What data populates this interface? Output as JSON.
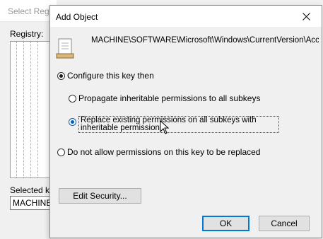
{
  "background_dialog": {
    "title": "Select Regi",
    "registry_label": "Registry:",
    "selected_key_label": "Selected ke",
    "selected_key_value": "MACHINE\\"
  },
  "dialog": {
    "title": "Add Object",
    "key_path": "MACHINE\\SOFTWARE\\Microsoft\\Windows\\CurrentVersion\\Acc",
    "options": {
      "configure": {
        "label": "Configure this key then",
        "selected": true
      },
      "propagate": {
        "label": "Propagate inheritable permissions to all subkeys",
        "selected": false
      },
      "replace": {
        "label": "Replace existing permissions on all subkeys with inheritable permissions",
        "selected": true
      },
      "do_not_allow": {
        "label": "Do not allow permissions on this key to be replaced",
        "selected": false
      }
    },
    "buttons": {
      "edit_security": "Edit Security...",
      "ok": "OK",
      "cancel": "Cancel"
    }
  },
  "colors": {
    "accent": "#0078d7",
    "radio_selected": "#0060c0"
  },
  "icons": {
    "close": "close-icon",
    "document": "registry-key-document-icon",
    "cursor": "mouse-pointer-icon"
  }
}
